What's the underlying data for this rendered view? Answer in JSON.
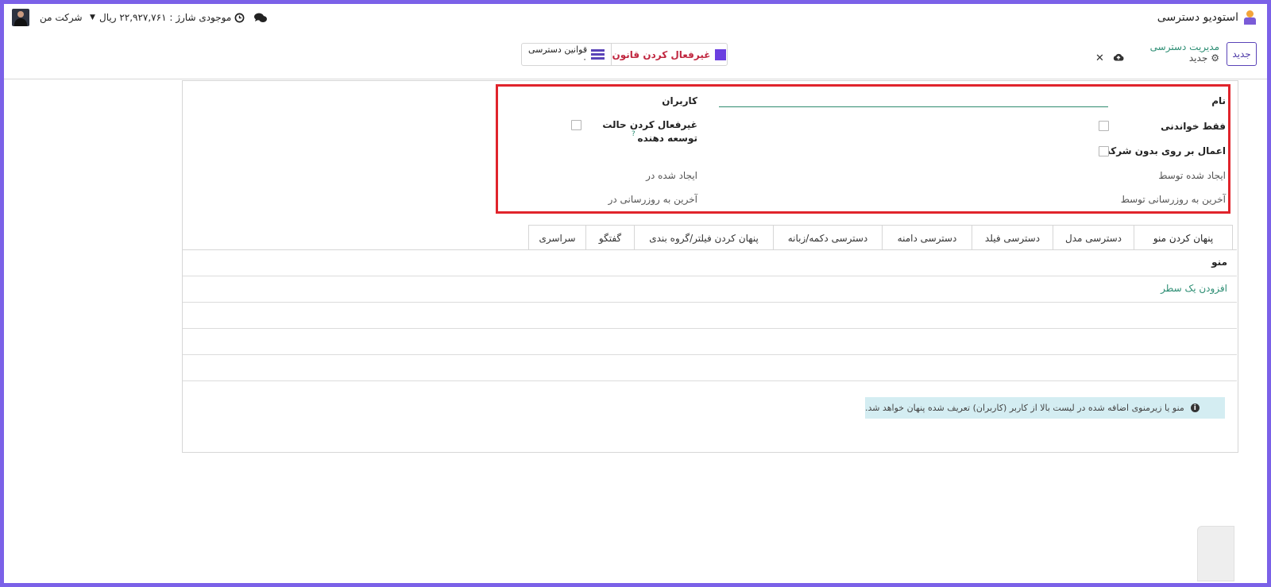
{
  "navbar": {
    "app_title": "استودیو دسترسی",
    "company": "شرکت من",
    "balance": "موجودی شارژ : ۲۲,۹۲۷,۷۶۱ ریال"
  },
  "control_panel": {
    "new_button": "جدید",
    "breadcrumb_parent": "مدیریت دسترسی",
    "breadcrumb_current": "جدید",
    "deactivate_rule_button": "غیرفعال کردن قانون",
    "access_rules_button": "قوانین دسترسی",
    "access_rules_count": "۰"
  },
  "form": {
    "name_label": "نام",
    "users_label": "کاربران",
    "read_only_label": "فقط خواندنی",
    "apply_without_company_label": "اعمال بر روی بدون شرکت",
    "disable_dev_mode_line1": "غیرفعال کردن حالت",
    "disable_dev_mode_line2": "توسعه دهنده",
    "help_mark": "?",
    "created_by_label": "ایجاد شده توسط",
    "created_on_label": "ایجاد شده در",
    "last_updated_by_label": "آخرین به روزرسانی توسط",
    "last_updated_on_label": "آخرین به روزرسانی در"
  },
  "tabs": [
    {
      "label": "پنهان کردن منو"
    },
    {
      "label": "دسترسی مدل"
    },
    {
      "label": "دسترسی فیلد"
    },
    {
      "label": "دسترسی دامنه"
    },
    {
      "label": "دسترسی دکمه/زبانه"
    },
    {
      "label": "پنهان کردن فیلتر/گروه بندی"
    },
    {
      "label": "گفتگو"
    },
    {
      "label": "سراسری"
    }
  ],
  "menu_tab": {
    "column_header": "منو",
    "add_line": "افزودن یک سطر",
    "info_text": "منو یا زیرمنوی اضافه شده در لیست بالا از کاربر (کاربران) تعریف شده پنهان خواهد شد."
  },
  "colors": {
    "accent": "#5a43b8",
    "link_green": "#2c8d73",
    "highlight_red": "#e0242c",
    "frame_purple": "#7b61e8"
  }
}
